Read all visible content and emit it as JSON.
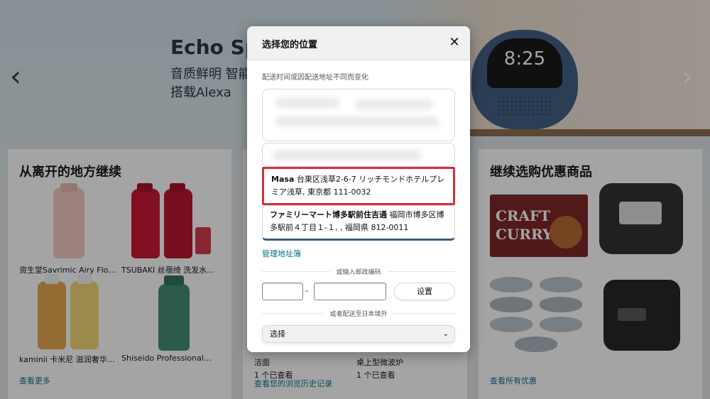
{
  "hero": {
    "title": "Echo Sp",
    "line1": "音质鲜明 智能",
    "line2": "搭载Alexa",
    "clock": "8:25",
    "prev_glyph": "‹",
    "next_glyph": "›"
  },
  "left_card": {
    "title": "从离开的地方继续",
    "products": [
      {
        "caption": "资生堂Savrimic Airy Flo…"
      },
      {
        "caption": "TSUBAKI 丝蓓绮 洗发水…"
      },
      {
        "caption": "kaminii 卡米尼 滋润奢华…"
      },
      {
        "caption": "Shiseido Professional…"
      }
    ],
    "link": "查看更多"
  },
  "mid_card": {
    "items": [
      {
        "name": "洁面",
        "viewed": "1 个已查看"
      },
      {
        "name": "桌上型微波炉",
        "viewed": "1 个已查看"
      }
    ],
    "link": "查看您的浏览历史记录"
  },
  "right_card": {
    "title": "继续选购优惠商品",
    "craft_line1": "CRAFT",
    "craft_line2": "CURRY",
    "link": "查看所有优惠"
  },
  "modal": {
    "title": "选择您的位置",
    "close_glyph": "✕",
    "hint": "配送时间或因配送地址不同而变化",
    "selected_address": {
      "name": "Masa",
      "detail": " 台東区浅草2-6-7 リッチモンドホテルプレミア浅草, 東京都 111-0032"
    },
    "alt_address": {
      "name": "ファミリーマート博多駅前住吉通",
      "detail": " 福岡市博多区博多駅前４丁目１-１, , 福岡県 812-0011"
    },
    "manage_link": "管理地址簿",
    "zip_divider": "或输入邮政编码",
    "zip_dash": "-",
    "set_button": "设置",
    "intl_divider": "或者配送至日本境外",
    "country_select": "选择",
    "chevron_glyph": "⌄"
  }
}
